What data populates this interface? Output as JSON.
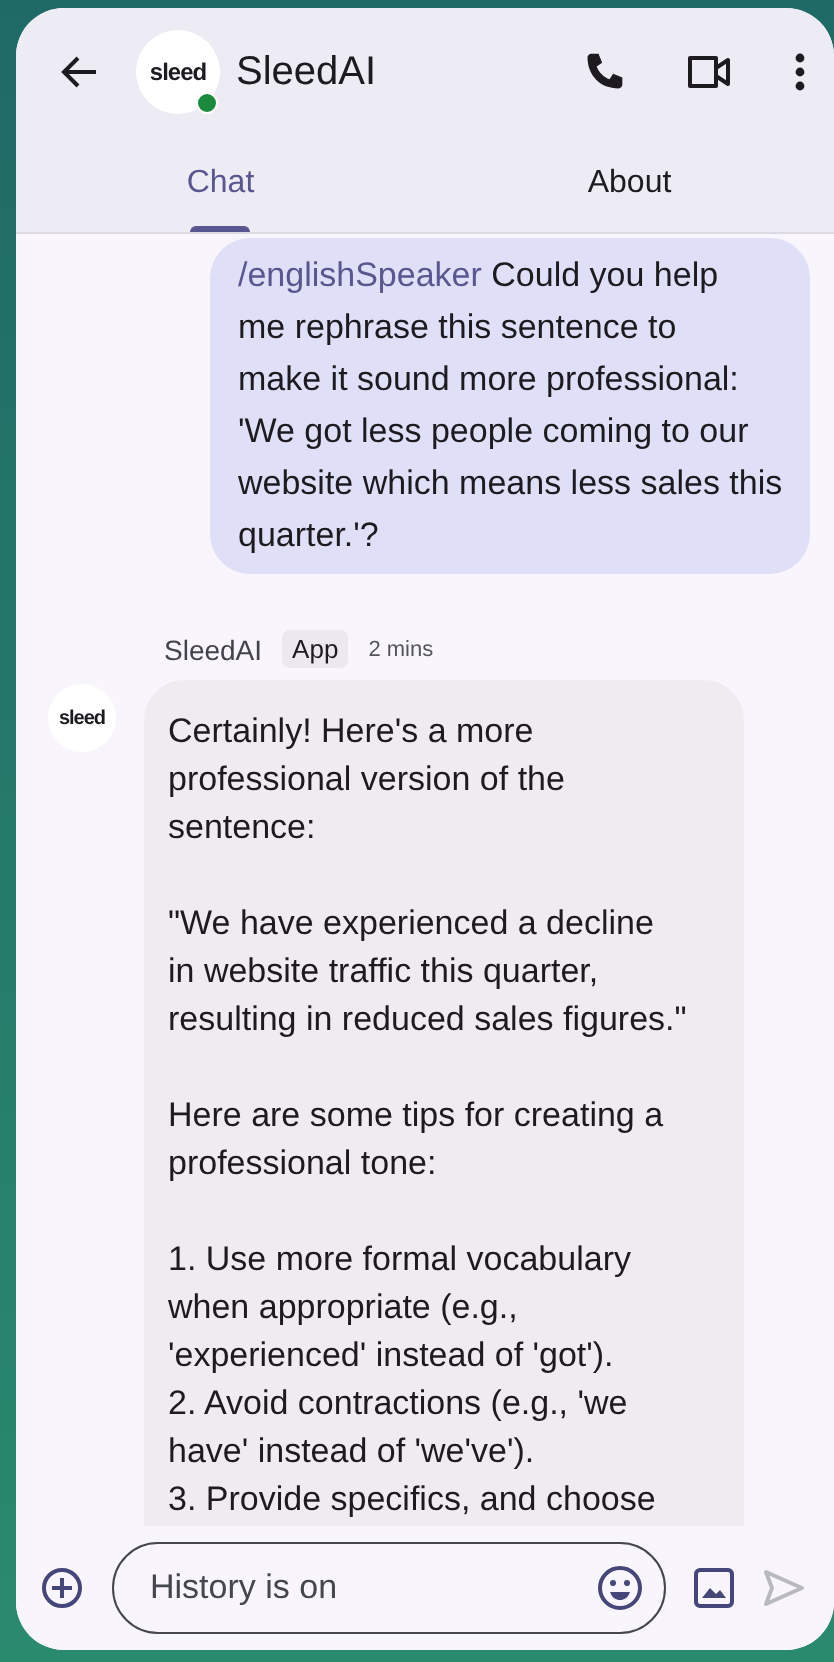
{
  "header": {
    "logo_text": "sleed",
    "online": true,
    "title": "SleedAI"
  },
  "tabs": [
    {
      "label": "Chat",
      "selected": true
    },
    {
      "label": "About",
      "selected": false
    }
  ],
  "messages": [
    {
      "kind": "user",
      "command": "/englishSpeaker",
      "lines": [
        "Could you help",
        "me rephrase this sentence to",
        "make it sound more professional:",
        "'We got less people coming to our",
        "website which means less sales this",
        "quarter.'?"
      ]
    },
    {
      "kind": "bot",
      "sender": "SleedAI",
      "badge": "App",
      "time": "2 mins",
      "logo_text": "sleed",
      "paragraphs": [
        [
          "Certainly! Here's a more",
          "professional version of the",
          "sentence:"
        ],
        [
          "\"We have experienced a decline",
          "in website traffic this quarter,",
          "resulting in reduced sales figures.\""
        ],
        [
          "Here are some tips for creating a",
          "professional tone:"
        ],
        [
          "1. Use more formal vocabulary",
          "when appropriate (e.g.,",
          "'experienced' instead of 'got').",
          "2. Avoid contractions (e.g., 'we",
          "have' instead of 'we've').",
          "3. Provide specifics, and choose"
        ]
      ]
    }
  ],
  "composer": {
    "placeholder": "History is on"
  }
}
